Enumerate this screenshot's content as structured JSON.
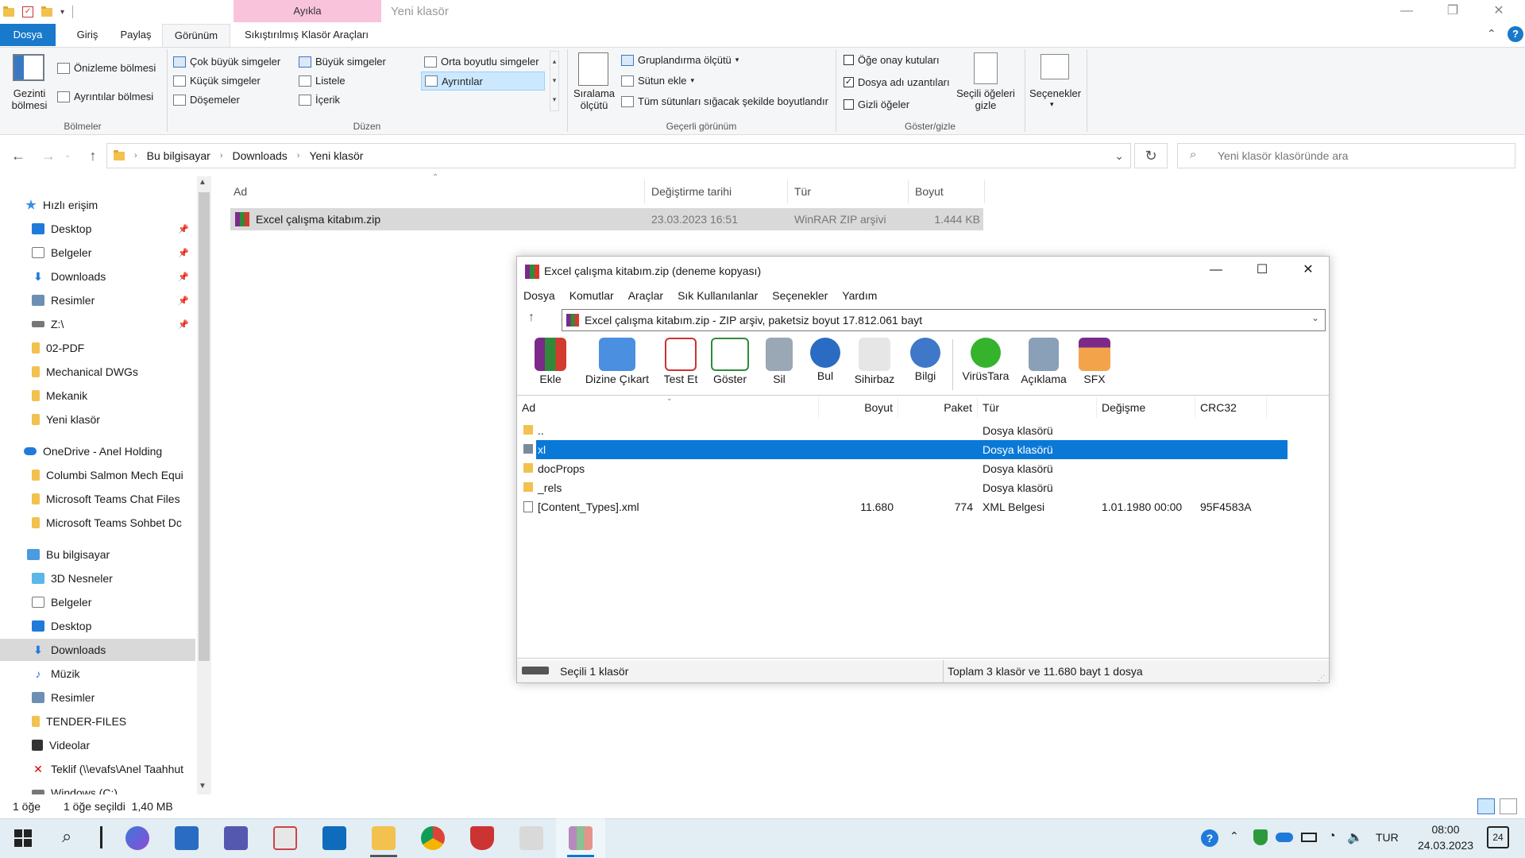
{
  "explorer": {
    "title": "Yeni klasör",
    "context_tab": "Ayıkla",
    "ribbon_tabs": [
      "Dosya",
      "Giriş",
      "Paylaş",
      "Görünüm",
      "Sıkıştırılmış Klasör Araçları"
    ],
    "ribbon": {
      "panes": {
        "nav_pane": "Gezinti bölmesi",
        "preview_pane": "Önizleme bölmesi",
        "details_pane": "Ayrıntılar bölmesi",
        "group_label": "Bölmeler"
      },
      "layout": {
        "items": [
          "Çok büyük simgeler",
          "Büyük simgeler",
          "Orta boyutlu simgeler",
          "Küçük simgeler",
          "Listele",
          "Ayrıntılar",
          "Döşemeler",
          "İçerik"
        ],
        "group_label": "Düzen"
      },
      "current_view": {
        "sort": "Sıralama ölçütü",
        "group": "Gruplandırma ölçütü",
        "add_column": "Sütun ekle",
        "fit_columns": "Tüm sütunları sığacak şekilde boyutlandır",
        "group_label": "Geçerli görünüm"
      },
      "show_hide": {
        "item_checkboxes": "Öğe onay kutuları",
        "extensions": "Dosya adı uzantıları",
        "hidden_items": "Gizli öğeler",
        "hide_selected": "Seçili öğeleri gizle",
        "options": "Seçenekler",
        "group_label": "Göster/gizle"
      }
    },
    "breadcrumb": [
      "Bu bilgisayar",
      "Downloads",
      "Yeni klasör"
    ],
    "search_placeholder": "Yeni klasör klasöründe ara",
    "sidebar": [
      {
        "label": "Hızlı erişim",
        "level": 0
      },
      {
        "label": "Desktop",
        "level": 1,
        "pinned": true
      },
      {
        "label": "Belgeler",
        "level": 1,
        "pinned": true
      },
      {
        "label": "Downloads",
        "level": 1,
        "pinned": true
      },
      {
        "label": "Resimler",
        "level": 1,
        "pinned": true
      },
      {
        "label": "Z:\\",
        "level": 1,
        "pinned": true
      },
      {
        "label": "02-PDF",
        "level": 1
      },
      {
        "label": "Mechanical DWGs",
        "level": 1
      },
      {
        "label": "Mekanik",
        "level": 1
      },
      {
        "label": "Yeni klasör",
        "level": 1
      },
      {
        "label": "OneDrive - Anel Holding",
        "level": 0
      },
      {
        "label": "Columbi Salmon Mech Equi",
        "level": 1
      },
      {
        "label": "Microsoft Teams Chat Files",
        "level": 1
      },
      {
        "label": "Microsoft Teams Sohbet Dc",
        "level": 1
      },
      {
        "label": "Bu bilgisayar",
        "level": 0
      },
      {
        "label": "3D Nesneler",
        "level": 1
      },
      {
        "label": "Belgeler",
        "level": 1
      },
      {
        "label": "Desktop",
        "level": 1
      },
      {
        "label": "Downloads",
        "level": 1,
        "selected": true
      },
      {
        "label": "Müzik",
        "level": 1
      },
      {
        "label": "Resimler",
        "level": 1
      },
      {
        "label": "TENDER-FILES",
        "level": 1
      },
      {
        "label": "Videolar",
        "level": 1
      },
      {
        "label": "Teklif (\\\\evafs\\Anel Taahhut",
        "level": 1
      },
      {
        "label": "Windows (C:)",
        "level": 1
      }
    ],
    "columns": [
      "Ad",
      "Değiştirme tarihi",
      "Tür",
      "Boyut"
    ],
    "files": [
      {
        "name": "Excel çalışma kitabım.zip",
        "modified": "23.03.2023 16:51",
        "type": "WinRAR ZIP arşivi",
        "size": "1.444 KB"
      }
    ],
    "status": {
      "count": "1 öğe",
      "selected": "1 öğe seçildi  1,40 MB"
    }
  },
  "winrar": {
    "title": "Excel çalışma kitabım.zip (deneme kopyası)",
    "menu": [
      "Dosya",
      "Komutlar",
      "Araçlar",
      "Sık Kullanılanlar",
      "Seçenekler",
      "Yardım"
    ],
    "address": "Excel çalışma kitabım.zip - ZIP arşiv, paketsiz boyut 17.812.061 bayt",
    "toolbar": [
      "Ekle",
      "Dizine Çıkart",
      "Test Et",
      "Göster",
      "Sil",
      "Bul",
      "Sihirbaz",
      "Bilgi",
      "VirüsTara",
      "Açıklama",
      "SFX"
    ],
    "columns": [
      "Ad",
      "Boyut",
      "Paket",
      "Tür",
      "Değişme",
      "CRC32"
    ],
    "rows": [
      {
        "name": "..",
        "size": "",
        "packed": "",
        "type": "Dosya klasörü",
        "modified": "",
        "crc": ""
      },
      {
        "name": "xl",
        "size": "",
        "packed": "",
        "type": "Dosya klasörü",
        "modified": "",
        "crc": "",
        "selected": true
      },
      {
        "name": "docProps",
        "size": "",
        "packed": "",
        "type": "Dosya klasörü",
        "modified": "",
        "crc": ""
      },
      {
        "name": "_rels",
        "size": "",
        "packed": "",
        "type": "Dosya klasörü",
        "modified": "",
        "crc": ""
      },
      {
        "name": "[Content_Types].xml",
        "size": "11.680",
        "packed": "774",
        "type": "XML Belgesi",
        "modified": "1.01.1980 00:00",
        "crc": "95F4583A"
      }
    ],
    "status_left": "Seçili 1 klasör",
    "status_right": "Toplam 3 klasör ve 11.680 bayt 1 dosya"
  },
  "taskbar": {
    "lang": "TUR",
    "time": "08:00",
    "date": "24.03.2023",
    "notifications": "24"
  }
}
